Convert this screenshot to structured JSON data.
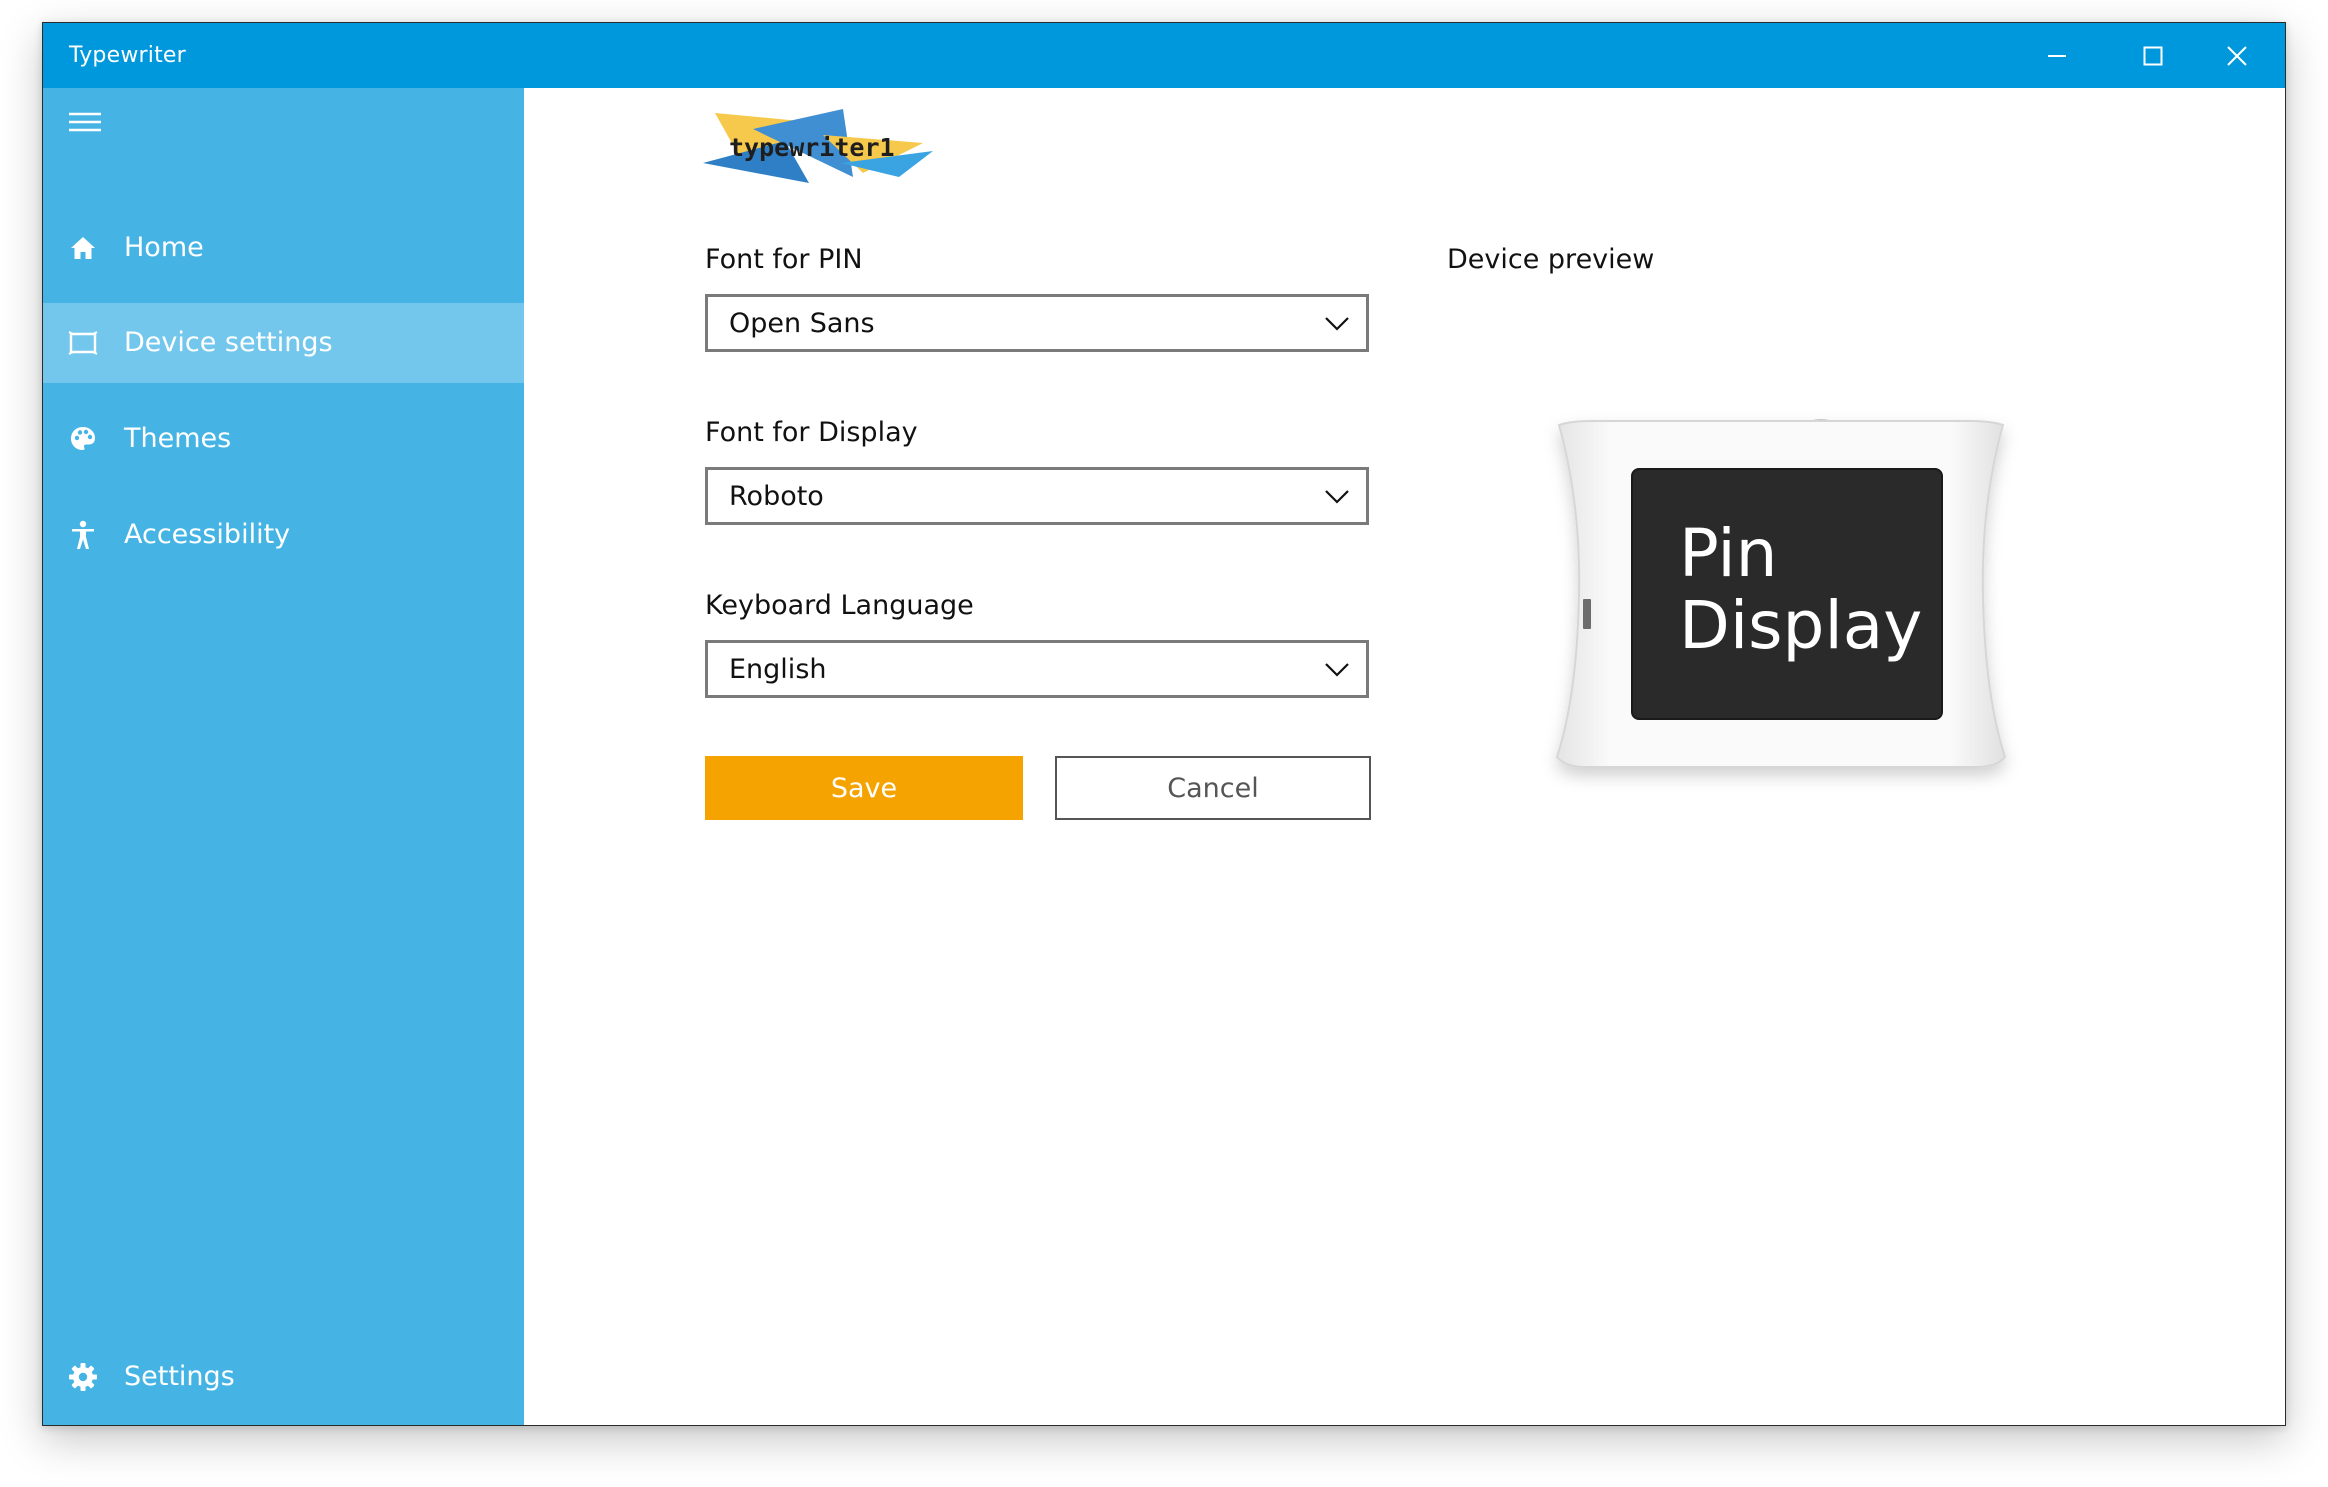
{
  "window": {
    "title": "Typewriter"
  },
  "titlebar": {
    "controls": [
      "minimize-icon",
      "maximize-icon",
      "close-icon"
    ]
  },
  "sidebar": {
    "menu_icon": "hamburger-icon",
    "items": [
      {
        "label": "Home",
        "icon": "home-icon",
        "active": false
      },
      {
        "label": "Device settings",
        "icon": "device-icon",
        "active": true
      },
      {
        "label": "Themes",
        "icon": "palette-icon",
        "active": false
      },
      {
        "label": "Accessibility",
        "icon": "accessibility-icon",
        "active": false
      }
    ],
    "footer": {
      "label": "Settings",
      "icon": "gear-icon"
    }
  },
  "logo": {
    "text": "typewriter1"
  },
  "form": {
    "pin_font": {
      "label": "Font for PIN",
      "value": "Open Sans"
    },
    "display_font": {
      "label": "Font for Display",
      "value": "Roboto"
    },
    "keyboard_language": {
      "label": "Keyboard Language",
      "value": "English"
    },
    "save_label": "Save",
    "cancel_label": "Cancel"
  },
  "preview": {
    "label": "Device preview",
    "screen_lines": [
      "Pin",
      "Display"
    ]
  },
  "colors": {
    "titlebar": "#0098dc",
    "sidebar": "#45b4e4",
    "sidebar_active": "#74c7ec",
    "save_button": "#f5a300"
  }
}
